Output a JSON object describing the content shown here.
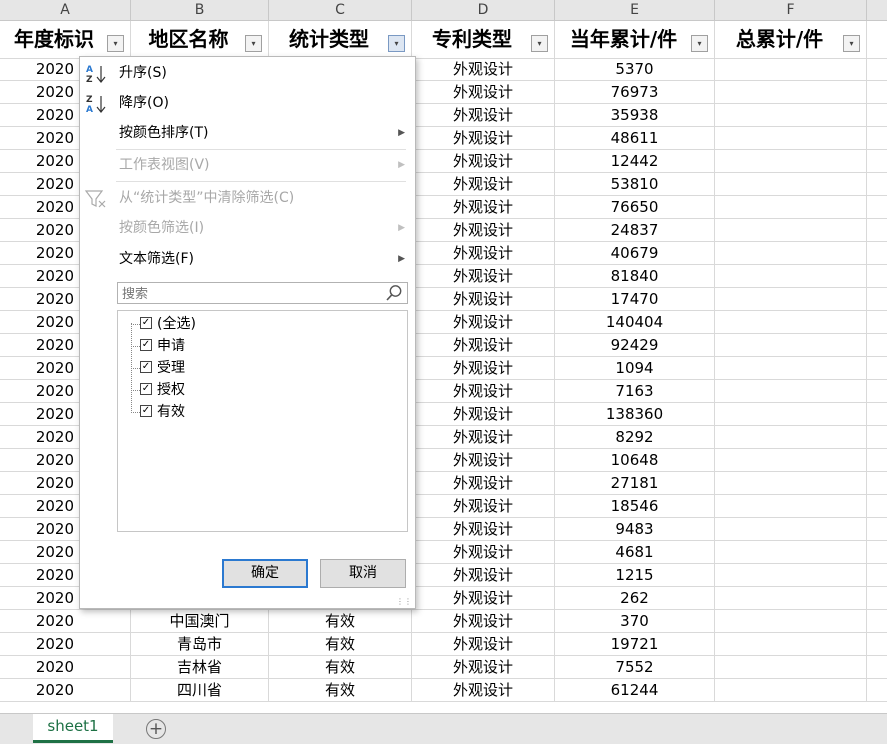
{
  "column_letters": [
    "A",
    "B",
    "C",
    "D",
    "E",
    "F"
  ],
  "headers": [
    "年度标识",
    "地区名称",
    "统计类型",
    "专利类型",
    "当年累计/件",
    "总累计/件"
  ],
  "filter_button_glyph": "▾",
  "rows": [
    [
      "2020",
      "",
      "",
      "外观设计",
      "5370",
      ""
    ],
    [
      "2020",
      "",
      "",
      "外观设计",
      "76973",
      ""
    ],
    [
      "2020",
      "",
      "",
      "外观设计",
      "35938",
      ""
    ],
    [
      "2020",
      "",
      "",
      "外观设计",
      "48611",
      ""
    ],
    [
      "2020",
      "",
      "",
      "外观设计",
      "12442",
      ""
    ],
    [
      "2020",
      "",
      "",
      "外观设计",
      "53810",
      ""
    ],
    [
      "2020",
      "",
      "",
      "外观设计",
      "76650",
      ""
    ],
    [
      "2020",
      "",
      "",
      "外观设计",
      "24837",
      ""
    ],
    [
      "2020",
      "",
      "",
      "外观设计",
      "40679",
      ""
    ],
    [
      "2020",
      "",
      "",
      "外观设计",
      "81840",
      ""
    ],
    [
      "2020",
      "",
      "",
      "外观设计",
      "17470",
      ""
    ],
    [
      "2020",
      "",
      "",
      "外观设计",
      "140404",
      ""
    ],
    [
      "2020",
      "",
      "",
      "外观设计",
      "92429",
      ""
    ],
    [
      "2020",
      "",
      "",
      "外观设计",
      "1094",
      ""
    ],
    [
      "2020",
      "",
      "",
      "外观设计",
      "7163",
      ""
    ],
    [
      "2020",
      "",
      "",
      "外观设计",
      "138360",
      ""
    ],
    [
      "2020",
      "",
      "",
      "外观设计",
      "8292",
      ""
    ],
    [
      "2020",
      "",
      "",
      "外观设计",
      "10648",
      ""
    ],
    [
      "2020",
      "",
      "",
      "外观设计",
      "27181",
      ""
    ],
    [
      "2020",
      "",
      "",
      "外观设计",
      "18546",
      ""
    ],
    [
      "2020",
      "",
      "",
      "外观设计",
      "9483",
      ""
    ],
    [
      "2020",
      "",
      "",
      "外观设计",
      "4681",
      ""
    ],
    [
      "2020",
      "",
      "",
      "外观设计",
      "1215",
      ""
    ],
    [
      "2020",
      "",
      "",
      "外观设计",
      "262",
      ""
    ],
    [
      "2020",
      "中国澳门",
      "有效",
      "外观设计",
      "370",
      ""
    ],
    [
      "2020",
      "青岛市",
      "有效",
      "外观设计",
      "19721",
      ""
    ],
    [
      "2020",
      "吉林省",
      "有效",
      "外观设计",
      "7552",
      ""
    ],
    [
      "2020",
      "四川省",
      "有效",
      "外观设计",
      "61244",
      ""
    ]
  ],
  "filter_menu": {
    "sort_asc": "升序(S)",
    "sort_desc": "降序(O)",
    "sort_by_color": "按颜色排序(T)",
    "sheet_view": "工作表视图(V)",
    "clear_filter": "从“统计类型”中清除筛选(C)",
    "filter_by_color": "按颜色筛选(I)",
    "text_filter": "文本筛选(F)",
    "search_placeholder": "搜索",
    "values": [
      {
        "label": "(全选)",
        "checked": true
      },
      {
        "label": "申请",
        "checked": true
      },
      {
        "label": "受理",
        "checked": true
      },
      {
        "label": "授权",
        "checked": true
      },
      {
        "label": "有效",
        "checked": true
      }
    ],
    "ok": "确定",
    "cancel": "取消"
  },
  "sheet_tabs": [
    "sheet1"
  ],
  "add_sheet_glyph": "+",
  "colors": {
    "accent": "#1e7145",
    "ok_border": "#2b79d0"
  }
}
